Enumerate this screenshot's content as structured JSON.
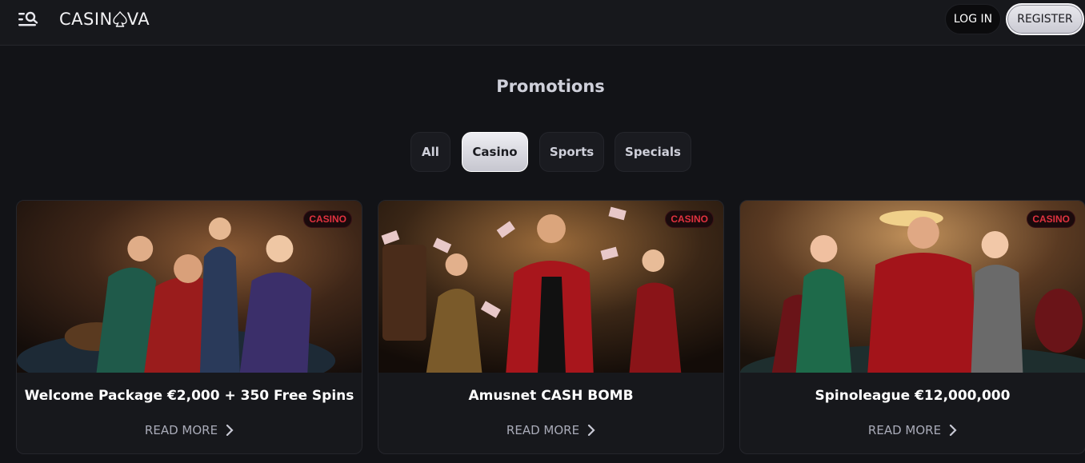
{
  "header": {
    "logo_text_left": "CASIN",
    "logo_text_right": "VA",
    "login_label": "LOG IN",
    "register_label": "REGISTER",
    "menu_icon": "menu-search-icon"
  },
  "page": {
    "title": "Promotions"
  },
  "tabs": [
    {
      "label": "All",
      "active": false
    },
    {
      "label": "Casino",
      "active": true
    },
    {
      "label": "Sports",
      "active": false
    },
    {
      "label": "Specials",
      "active": false
    }
  ],
  "cards": [
    {
      "badge": "CASINO",
      "title": "Welcome Package €2,000 + 350 Free Spins",
      "cta": "READ MORE"
    },
    {
      "badge": "CASINO",
      "title": "Amusnet CASH BOMB",
      "cta": "READ MORE"
    },
    {
      "badge": "CASINO",
      "title": "Spinoleague €12,000,000",
      "cta": "READ MORE"
    }
  ],
  "colors": {
    "background": "#121317",
    "badge_text": "#e0323f",
    "active_tab": "#e2e2e8"
  }
}
